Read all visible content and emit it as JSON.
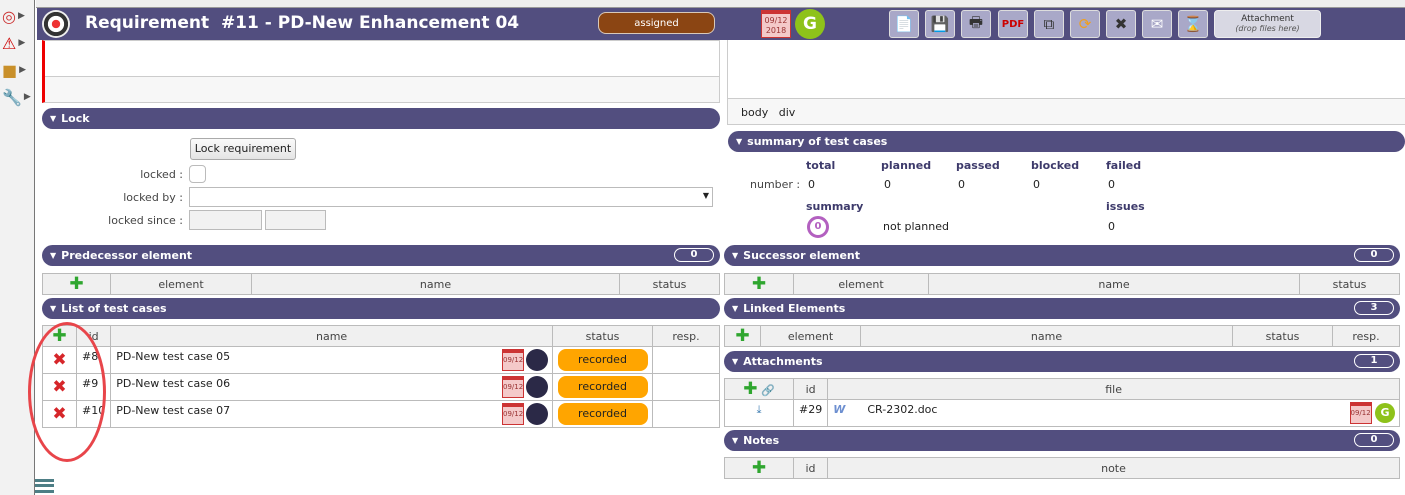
{
  "header": {
    "title": "Requirement  #11 - PD-New Enhancement 04",
    "status": "assigned",
    "date": "09/12\n2018",
    "user_initial": "G",
    "attachment_label": "Attachment",
    "attachment_hint": "(drop files here)"
  },
  "editor": {
    "path": [
      "body",
      "div"
    ]
  },
  "lock": {
    "title": "Lock",
    "button": "Lock requirement",
    "locked_label": "locked :",
    "locked_by_label": "locked by :",
    "locked_since_label": "locked since :"
  },
  "summary": {
    "title": "summary of test cases",
    "row_label": "number :",
    "columns": [
      "total",
      "planned",
      "passed",
      "blocked",
      "failed"
    ],
    "values": [
      "0",
      "0",
      "0",
      "0",
      "0"
    ],
    "summary_label": "summary",
    "summary_value": "not planned",
    "issues_label": "issues",
    "issues_value": "0",
    "summary_icon_text": "0"
  },
  "predecessor": {
    "title": "Predecessor element",
    "count": "0",
    "columns": [
      "element",
      "name",
      "status"
    ]
  },
  "successor": {
    "title": "Successor element",
    "count": "0",
    "columns": [
      "element",
      "name",
      "status"
    ]
  },
  "test_cases": {
    "title": "List of test cases",
    "columns": [
      "id",
      "name",
      "status",
      "resp."
    ],
    "rows": [
      {
        "id": "#8",
        "name": "PD-New test case 05",
        "date": "09/12",
        "status": "recorded"
      },
      {
        "id": "#9",
        "name": "PD-New test case 06",
        "date": "09/12",
        "status": "recorded"
      },
      {
        "id": "#10",
        "name": "PD-New test case 07",
        "date": "09/12",
        "status": "recorded"
      }
    ]
  },
  "linked": {
    "title": "Linked Elements",
    "count": "3",
    "columns": [
      "element",
      "name",
      "status",
      "resp."
    ]
  },
  "attachments": {
    "title": "Attachments",
    "count": "1",
    "columns": [
      "id",
      "file"
    ],
    "rows": [
      {
        "id": "#29",
        "file": "CR-2302.doc",
        "date": "09/12",
        "user_initial": "G"
      }
    ]
  },
  "notes": {
    "title": "Notes",
    "count": "0",
    "columns": [
      "id",
      "note"
    ]
  },
  "colors": {
    "bar": "#524e7f",
    "recorded": "#ffa500",
    "assigned": "#8b4513"
  }
}
